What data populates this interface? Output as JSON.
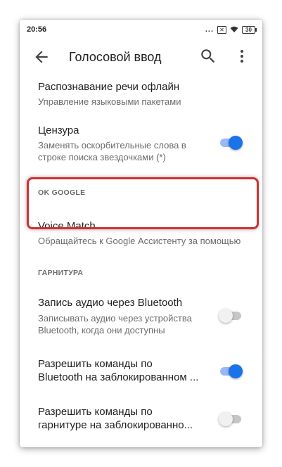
{
  "status_bar": {
    "time": "20:56",
    "dots": "...",
    "sim_label": "✕",
    "battery": "30"
  },
  "app_bar": {
    "title": "Голосовой ввод",
    "back_icon": "arrow-back-icon",
    "search_icon": "search-icon",
    "more_icon": "more-vert-icon"
  },
  "settings": {
    "offline": {
      "title": "Распознавание речи офлайн",
      "subtitle": "Управление языковыми пакетами"
    },
    "censor": {
      "title": "Цензура",
      "subtitle_line1": "Заменять оскорбительные слова в",
      "subtitle_line2": "строке поиска звездочками (*)",
      "enabled": true
    },
    "ok_google_header": "OK GOOGLE",
    "voice_match": {
      "title": "Voice Match",
      "subtitle": "Обращайтесь к Google Ассистенту за помощью"
    },
    "headset_header": "ГАРНИТУРА",
    "bt_audio": {
      "title": "Запись аудио через Bluetooth",
      "subtitle_line1": "Записывать аудио через устройства",
      "subtitle_line2": "Bluetooth, когда они доступны",
      "enabled": false
    },
    "bt_locked": {
      "title_line1": "Разрешить команды по",
      "title_line2": "Bluetooth на заблокированном ...",
      "enabled": true
    },
    "headset_locked": {
      "title_line1": "Разрешить команды по",
      "title_line2": "гарнитуре на заблокированно...",
      "enabled": false
    }
  },
  "colors": {
    "accent": "#1a73e8",
    "highlight": "#d32f2f"
  }
}
